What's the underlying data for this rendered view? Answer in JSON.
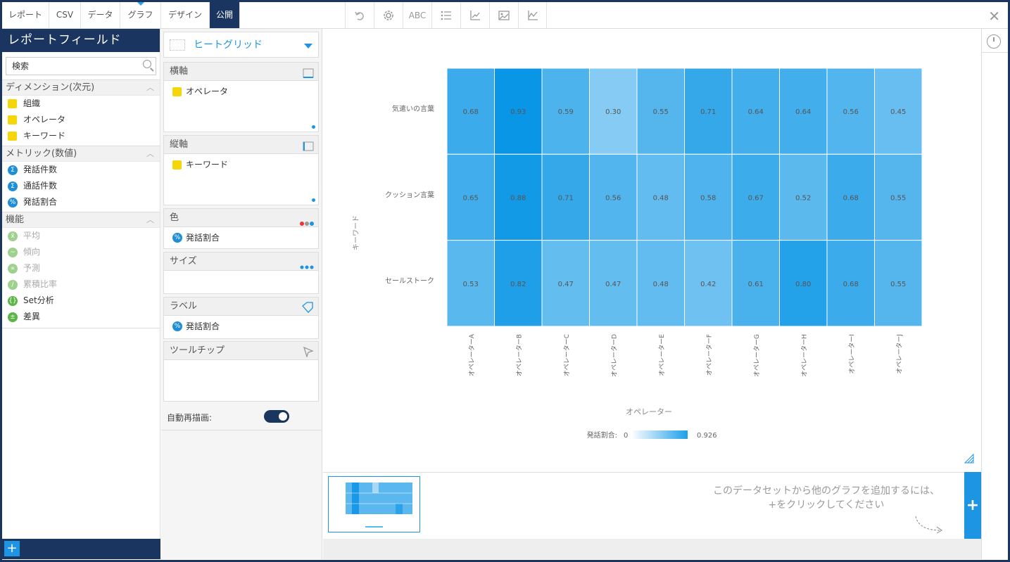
{
  "tabs": [
    "レポート",
    "CSV",
    "データ",
    "グラフ",
    "デザイン",
    "公開"
  ],
  "toolbar_icons": [
    "undo-icon",
    "settings-icon",
    "spellcheck-icon",
    "list-icon",
    "axis-icon",
    "image-icon",
    "line-chart-icon"
  ],
  "toolbar_abc": "ABC",
  "left": {
    "title": "レポートフィールド",
    "search_placeholder": "検索",
    "sections": [
      {
        "title": "ディメンション(次元)",
        "items": [
          "組織",
          "オペレータ",
          "キーワード"
        ]
      },
      {
        "title": "メトリック(数値)",
        "items": [
          "発話件数",
          "通話件数",
          "発話割合"
        ]
      },
      {
        "title": "機能",
        "items": [
          "平均",
          "傾向",
          "予測",
          "累積比率",
          "Set分析",
          "差異"
        ]
      }
    ]
  },
  "mid": {
    "chart_type": "ヒートグリッド",
    "x_axis": {
      "title": "横軸",
      "item": "オペレータ"
    },
    "y_axis": {
      "title": "縦軸",
      "item": "キーワード"
    },
    "color": {
      "title": "色",
      "item": "発話割合"
    },
    "size": {
      "title": "サイズ"
    },
    "label": {
      "title": "ラベル",
      "item": "発話割合"
    },
    "tooltip": {
      "title": "ツールチップ"
    },
    "auto_redraw": "自動再描画:"
  },
  "chart_data": {
    "type": "heatmap",
    "x": [
      "オペレーターA",
      "オペレーターB",
      "オペレーターC",
      "オペレーターD",
      "オペレーターE",
      "オペレーターF",
      "オペレーターG",
      "オペレーターH",
      "オペレーターI",
      "オペレーターJ"
    ],
    "y": [
      "気遣いの言葉",
      "クッション言葉",
      "セールストーク"
    ],
    "values": [
      [
        0.68,
        0.93,
        0.59,
        0.3,
        0.55,
        0.71,
        0.64,
        0.64,
        0.56,
        0.45
      ],
      [
        0.65,
        0.88,
        0.71,
        0.56,
        0.48,
        0.58,
        0.67,
        0.52,
        0.68,
        0.55
      ],
      [
        0.53,
        0.82,
        0.47,
        0.47,
        0.48,
        0.42,
        0.61,
        0.8,
        0.68,
        0.55
      ]
    ],
    "xlabel": "オペレーター",
    "ylabel": "キーワード",
    "legend_title": "発話割合:",
    "legend_min": "0",
    "legend_max": "0.926",
    "scale_min": 0,
    "scale_max": 0.926
  },
  "hint_text": "このデータセットから他のグラフを追加するには、+をクリックしてください"
}
